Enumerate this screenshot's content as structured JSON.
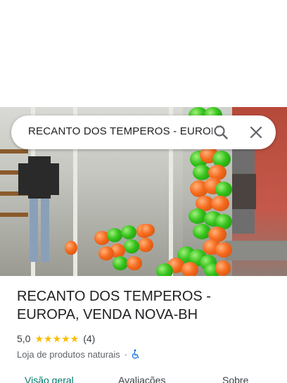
{
  "search": {
    "value": "RECANTO DOS TEMPEROS - EUROP"
  },
  "place": {
    "title": "RECANTO DOS TEMPEROS - EUROPA, VENDA NOVA-BH",
    "rating": "5,0",
    "stars": "★★★★★",
    "review_count": "(4)",
    "category": "Loja de produtos naturais",
    "separator": "·"
  },
  "tabs": [
    {
      "label": "Visão geral"
    },
    {
      "label": "Avaliações"
    },
    {
      "label": "Sobre"
    }
  ],
  "colors": {
    "star": "#fbbc04",
    "active_tab": "#00796b",
    "accessibility_icon": "#1a73e8"
  },
  "icons": {
    "search": "search-icon",
    "close": "close-icon",
    "wheelchair": "wheelchair-icon"
  }
}
